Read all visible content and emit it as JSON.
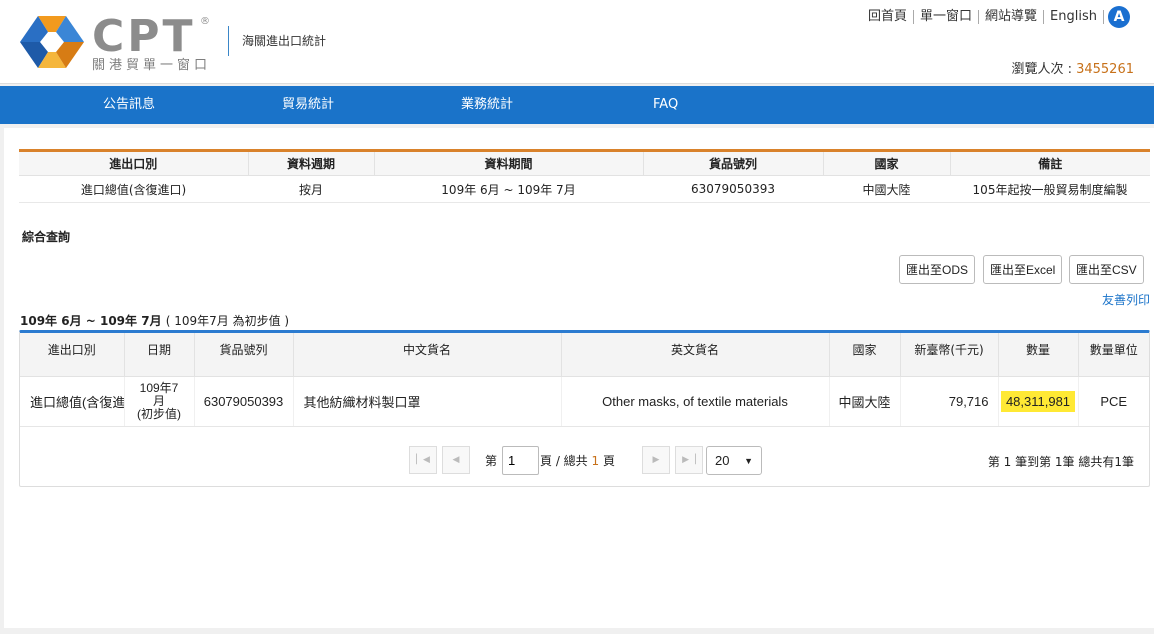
{
  "header": {
    "logo_text": "CPT",
    "logo_reg": "®",
    "logo_subtitle": "關港貿單一窗口",
    "site_title": "海關進出口統計",
    "top_links": [
      "回首頁",
      "單一窗口",
      "網站導覽",
      "English"
    ],
    "a11y_label": "A",
    "visitor_label": "瀏覽人次 : ",
    "visitor_count": "3455261"
  },
  "nav": [
    "公告訊息",
    "貿易統計",
    "業務統計",
    "FAQ"
  ],
  "summary": {
    "headers": [
      "進出口別",
      "資料週期",
      "資料期間",
      "貨品號列",
      "國家",
      "備註"
    ],
    "row": [
      "進口總值(含復進口)",
      "按月",
      "109年 6月 ~ 109年 7月",
      "63079050393",
      "中國大陸",
      "105年起按一般貿易制度編製"
    ]
  },
  "query_title": "綜合查詢",
  "exports": [
    "匯出至ODS",
    "匯出至Excel",
    "匯出至CSV"
  ],
  "print_label": "友善列印",
  "period_caption": "109年 6月 ~ 109年 7月",
  "period_note": "( 109年7月 為初步值 )",
  "results": {
    "headers": [
      "進出口別",
      "日期",
      "貨品號列",
      "中文貨名",
      "英文貨名",
      "國家",
      "新臺幣(千元)",
      "數量",
      "數量單位"
    ],
    "row": {
      "type": "進口總值(含復進",
      "date_line1": "109年7",
      "date_line2": "月",
      "date_line3": "(初步值)",
      "code": "63079050393",
      "name_zh": "其他紡織材料製口罩",
      "name_en": "Other masks, of textile materials",
      "country": "中國大陸",
      "value_ntd": "79,716",
      "quantity": "48,311,981",
      "unit": "PCE"
    }
  },
  "pager": {
    "label_pre": "第",
    "current_page": "1",
    "label_mid": "頁 / 總共",
    "total_pages": "1",
    "label_post": "頁",
    "page_size": "20",
    "summary": "第 1 筆到第 1筆 總共有1筆"
  }
}
